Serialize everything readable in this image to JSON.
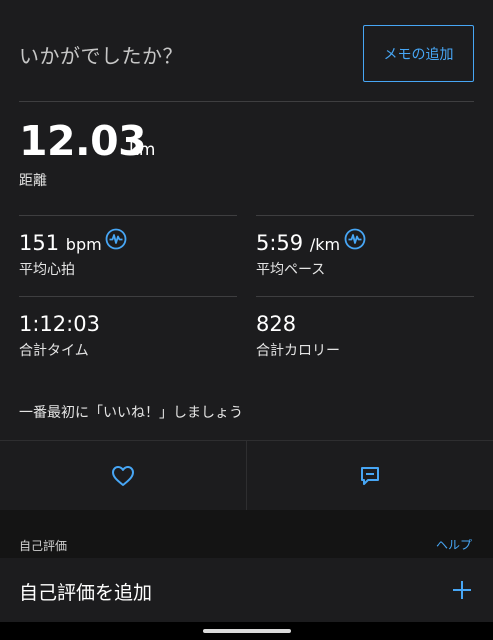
{
  "header": {
    "prompt": "いかがでしたか？",
    "memo_button": "メモの追加"
  },
  "distance": {
    "value": "12.03",
    "unit": "km",
    "label": "距離"
  },
  "stats": {
    "heart_rate": {
      "value": "151",
      "unit": "bpm",
      "label": "平均心拍",
      "icon": "heart-rate-icon"
    },
    "pace": {
      "value": "5:59",
      "unit": "/km",
      "label": "平均ペース",
      "icon": "heart-rate-icon"
    },
    "time": {
      "value": "1:12:03",
      "label": "合計タイム"
    },
    "calories": {
      "value": "828",
      "label": "合計カロリー"
    }
  },
  "like_prompt": "一番最初に「いいね！」しましょう",
  "actions": {
    "like_icon": "heart-icon",
    "comment_icon": "comment-icon"
  },
  "self_eval": {
    "section_label": "自己評価",
    "help": "ヘルプ",
    "add_label": "自己評価を追加",
    "add_icon": "plus-icon"
  },
  "colors": {
    "accent": "#47a6f5",
    "background": "#1c1c1e",
    "divider": "#3e3e40"
  }
}
